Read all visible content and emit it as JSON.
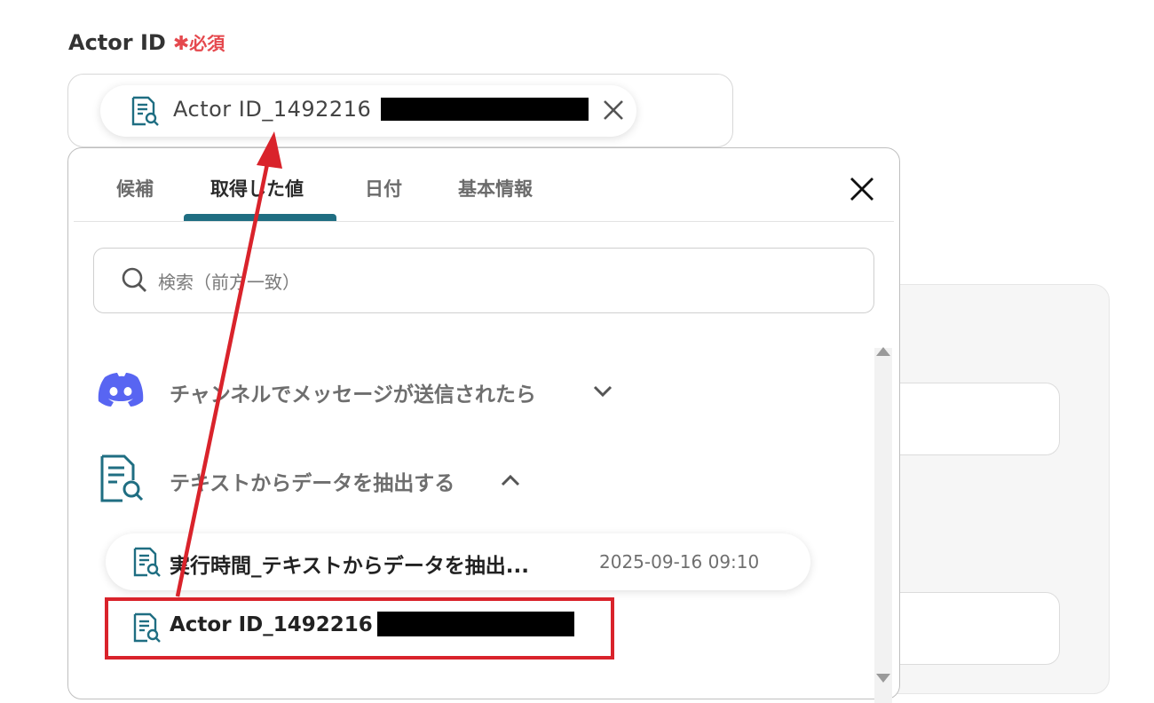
{
  "field": {
    "label": "Actor ID",
    "required_star": "✱",
    "required_text": "必須"
  },
  "chip": {
    "text": "Actor ID_1492216",
    "icon": "document-search-icon",
    "close_icon": "close-icon"
  },
  "popup": {
    "tabs": [
      {
        "label": "候補"
      },
      {
        "label": "取得した値"
      },
      {
        "label": "日付"
      },
      {
        "label": "基本情報"
      }
    ],
    "active_tab": "取得した値",
    "search_placeholder": "検索（前方一致）",
    "groups": [
      {
        "title": "チャンネルでメッセージが送信されたら",
        "icon": "discord-icon",
        "state": "collapsed"
      },
      {
        "title": "テキストからデータを抽出する",
        "icon": "document-search-icon",
        "state": "expanded"
      }
    ],
    "items": [
      {
        "title": "実行時間_テキストからデータを抽出...",
        "date": "2025-09-16 09:10"
      },
      {
        "title": "Actor ID_1492216"
      }
    ]
  },
  "colors": {
    "accent": "#1f6e82",
    "required": "#e5484d",
    "annotation": "#d9232b",
    "discord": "#5865f2"
  }
}
